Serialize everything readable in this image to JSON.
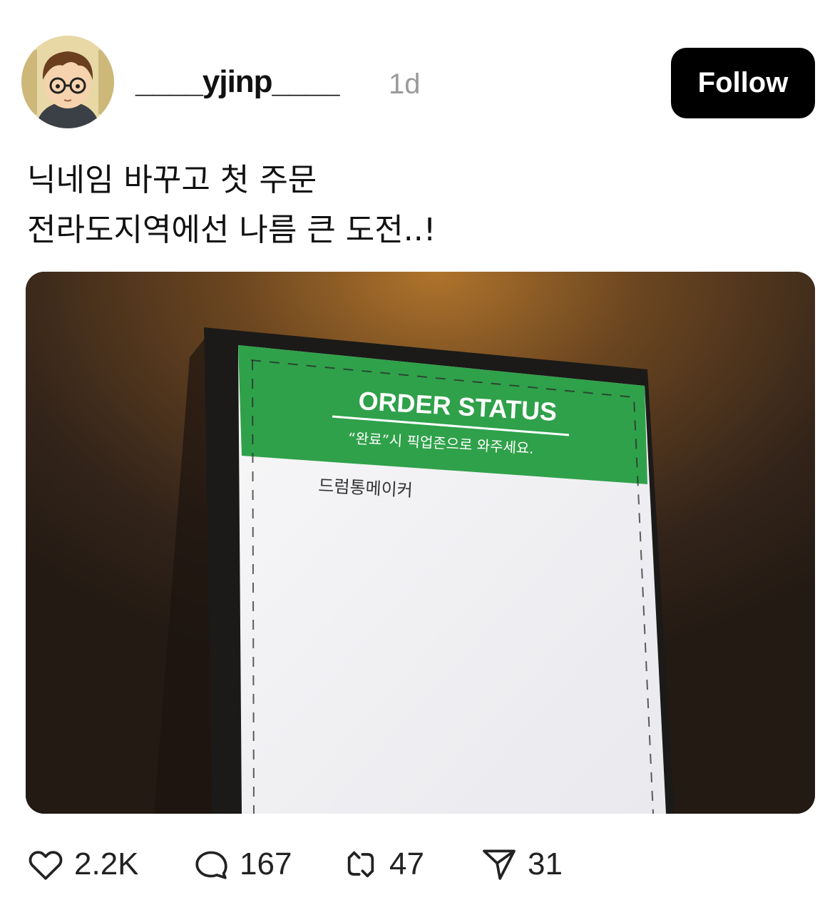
{
  "post": {
    "username": "____yjinp____",
    "time": "1d",
    "follow_label": "Follow",
    "text_lines": [
      "닉네임 바꾸고 첫 주문",
      "전라도지역에선 나름 큰 도전..!"
    ]
  },
  "photo": {
    "sign_title": "ORDER STATUS",
    "sign_subtitle": "“완료”시 픽업존으로 와주세요.",
    "order_name": "드럼통메이커"
  },
  "actions": {
    "likes": "2.2K",
    "replies": "167",
    "reposts": "47",
    "shares": "31"
  },
  "icons": [
    "heart-icon",
    "comment-icon",
    "repost-icon",
    "send-icon"
  ],
  "colors": {
    "follow_bg": "#000000",
    "sign_green": "#2fa14a",
    "time_gray": "#9a9a9a"
  }
}
